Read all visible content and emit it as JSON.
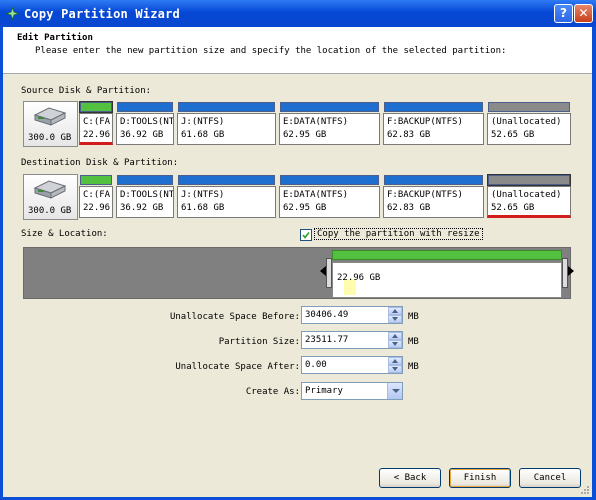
{
  "window": {
    "title": "Copy Partition Wizard",
    "help_label": "?",
    "close_label": "✕"
  },
  "header": {
    "title": "Edit Partition",
    "subtitle": "Please enter the new partition size and specify the location of the selected partition:"
  },
  "source": {
    "label": "Source Disk & Partition:",
    "disk_size": "300.0 GB",
    "partitions": [
      {
        "name": "C:(FA",
        "size": "22.96",
        "color": "#53c13f",
        "selected": true
      },
      {
        "name": "D:TOOLS(NT",
        "size": "36.92 GB",
        "color": "#1f6fd1"
      },
      {
        "name": "J:(NTFS)",
        "size": "61.68 GB",
        "color": "#1f6fd1"
      },
      {
        "name": "E:DATA(NTFS)",
        "size": "62.95 GB",
        "color": "#1f6fd1"
      },
      {
        "name": "F:BACKUP(NTFS)",
        "size": "62.83 GB",
        "color": "#1f6fd1"
      },
      {
        "name": "(Unallocated)",
        "size": "52.65 GB",
        "color": "#8a8a8a"
      }
    ]
  },
  "destination": {
    "label": "Destination Disk & Partition:",
    "disk_size": "300.0 GB",
    "partitions": [
      {
        "name": "C:(FA",
        "size": "22.96",
        "color": "#53c13f"
      },
      {
        "name": "D:TOOLS(NT",
        "size": "36.92 GB",
        "color": "#1f6fd1"
      },
      {
        "name": "J:(NTFS)",
        "size": "61.68 GB",
        "color": "#1f6fd1"
      },
      {
        "name": "E:DATA(NTFS)",
        "size": "62.95 GB",
        "color": "#1f6fd1"
      },
      {
        "name": "F:BACKUP(NTFS)",
        "size": "62.83 GB",
        "color": "#1f6fd1"
      },
      {
        "name": "(Unallocated)",
        "size": "52.65 GB",
        "color": "#8a8a8a",
        "selected": true
      }
    ]
  },
  "size_location": {
    "label": "Size & Location:",
    "copy_resize_label": "Copy the partition with resize",
    "copy_resize_checked": true,
    "partition_label": "22.96 GB"
  },
  "fields": {
    "before_label": "Unallocate Space Before:",
    "before_value": "30406.49",
    "size_label": "Partition Size:",
    "size_value": "23511.77",
    "after_label": "Unallocate Space After:",
    "after_value": "0.00",
    "unit": "MB",
    "create_label": "Create As:",
    "create_value": "Primary"
  },
  "buttons": {
    "back": "< Back",
    "finish": "Finish",
    "cancel": "Cancel"
  }
}
